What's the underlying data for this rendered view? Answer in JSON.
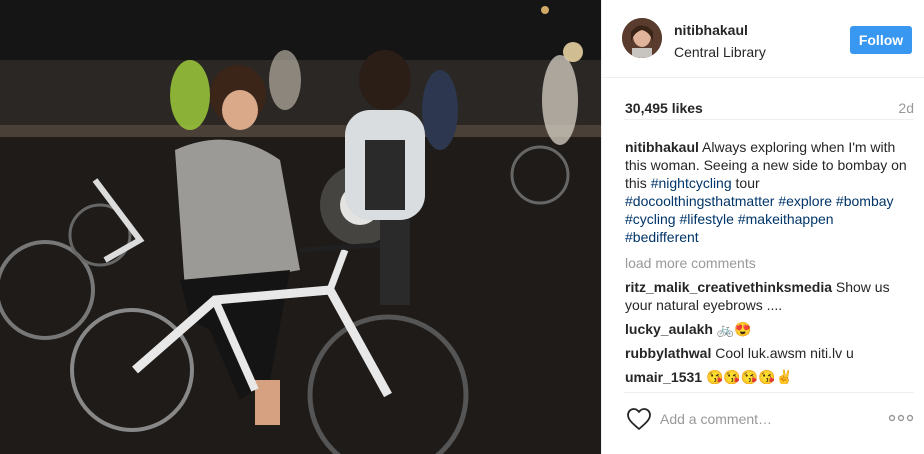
{
  "post": {
    "photo_alt": "",
    "user": {
      "username": "nitibhakaul",
      "location": "Central Library",
      "follow_label": "Follow"
    },
    "likes": "30,495 likes",
    "age": "2d",
    "caption": {
      "user": "nitibhakaul",
      "text_1": " Always exploring when I'm with this woman. Seeing a new side to bombay on this ",
      "tag_nightcycling": "#nightcycling",
      "text_2": " tour ",
      "tag_docool": "#docoolthingsthatmatter",
      "tag_explore": "#explore",
      "tag_bombay": "#bombay",
      "tag_cycling": "#cycling",
      "tag_lifestyle": "#lifestyle",
      "tag_makeithappen": "#makeithappen",
      "tag_bedifferent": "#bedifferent"
    },
    "load_more": "load more comments",
    "comments": [
      {
        "user": "ritz_malik_creativethinksmedia",
        "text": " Show us your natural eyebrows ...."
      },
      {
        "user": "lucky_aulakh",
        "text": " 🚲😍"
      },
      {
        "user": "rubbylathwal",
        "text": " Cool luk.awsm niti.lv u"
      },
      {
        "user": "umair_1531",
        "text": " 😘😘😘😘✌"
      }
    ],
    "add_comment_placeholder": "Add a comment…",
    "icons": {
      "heart": "heart-icon",
      "more": "more-options-icon"
    },
    "colors": {
      "follow": "#3897f0",
      "hashtag": "#003569",
      "muted": "#999999"
    }
  }
}
